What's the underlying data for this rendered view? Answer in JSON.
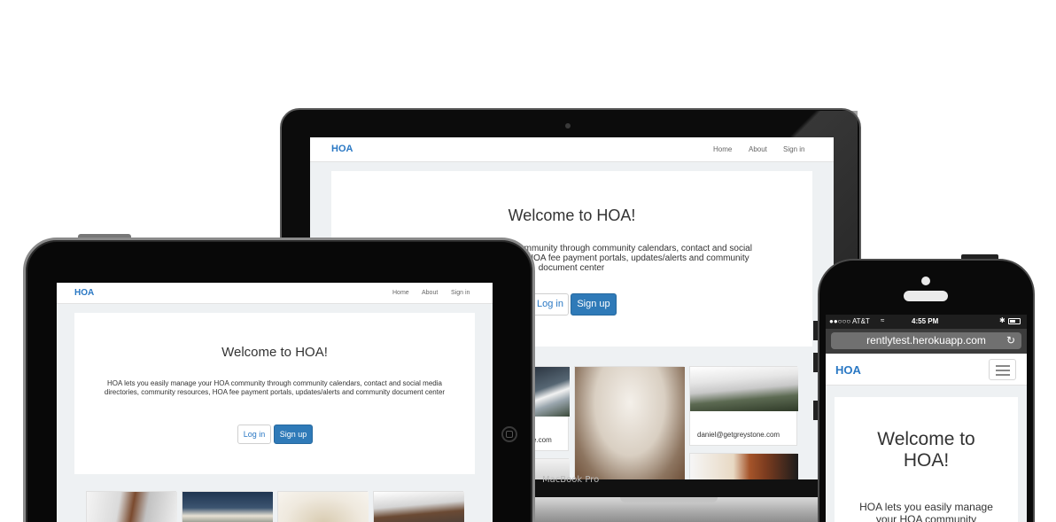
{
  "brand": "HOA",
  "nav": {
    "home": "Home",
    "about": "About",
    "signin": "Sign in"
  },
  "hero": {
    "title": "Welcome to HOA!",
    "description": "HOA lets you easily manage your HOA community through community calendars, contact and social media directories, community resources, HOA fee payment portals, updates/alerts and community document center"
  },
  "laptop": {
    "desc_line1": "community through community calendars, contact and social",
    "desc_line2": "s, HOA fee payment portals, updates/alerts and community",
    "desc_line3": "document center",
    "cards": [
      {
        "caption": "e.com"
      },
      {
        "caption": "daniel@getgreystone.com"
      }
    ],
    "chin_label": "MacBook Pro"
  },
  "buttons": {
    "login": "Log in",
    "signup": "Sign up"
  },
  "phone": {
    "carrier": "●●○○○ AT&T",
    "time": "4:55 PM",
    "url": "rentlytest.herokuapp.com",
    "title_line1": "Welcome to",
    "title_line2": "HOA!",
    "desc_line1": "HOA lets you easily manage",
    "desc_line2": "your HOA community"
  },
  "icons": [
    "wifi-icon",
    "bluetooth-icon",
    "battery-icon",
    "reload-icon",
    "hamburger-menu-icon",
    "camera-icon",
    "speaker-icon",
    "home-button-icon"
  ],
  "colors": {
    "brand": "#2a78c4",
    "primary_button": "#2f7ab8",
    "page_bg": "#eef1f3"
  }
}
